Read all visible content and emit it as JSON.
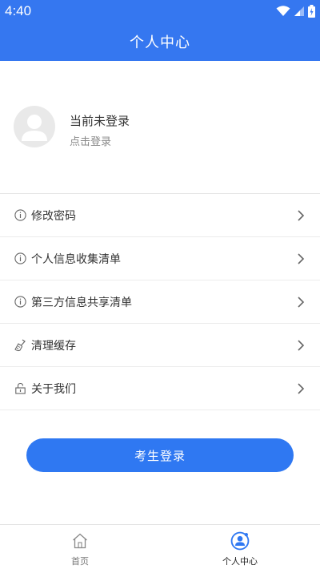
{
  "status_bar": {
    "time": "4:40"
  },
  "header": {
    "title": "个人中心"
  },
  "profile": {
    "name": "当前未登录",
    "login_hint": "点击登录"
  },
  "menu": {
    "items": [
      {
        "label": "修改密码",
        "icon": "info-icon"
      },
      {
        "label": "个人信息收集清单",
        "icon": "info-icon"
      },
      {
        "label": "第三方信息共享清单",
        "icon": "info-icon"
      },
      {
        "label": "清理缓存",
        "icon": "broom-icon"
      },
      {
        "label": "关于我们",
        "icon": "lock-icon"
      }
    ]
  },
  "login_button": {
    "label": "考生登录"
  },
  "tabbar": {
    "tabs": [
      {
        "label": "首页",
        "icon": "home-icon",
        "active": false
      },
      {
        "label": "个人中心",
        "icon": "user-icon",
        "active": true
      }
    ]
  },
  "colors": {
    "primary": "#3577f0",
    "button": "#2f78f2"
  }
}
